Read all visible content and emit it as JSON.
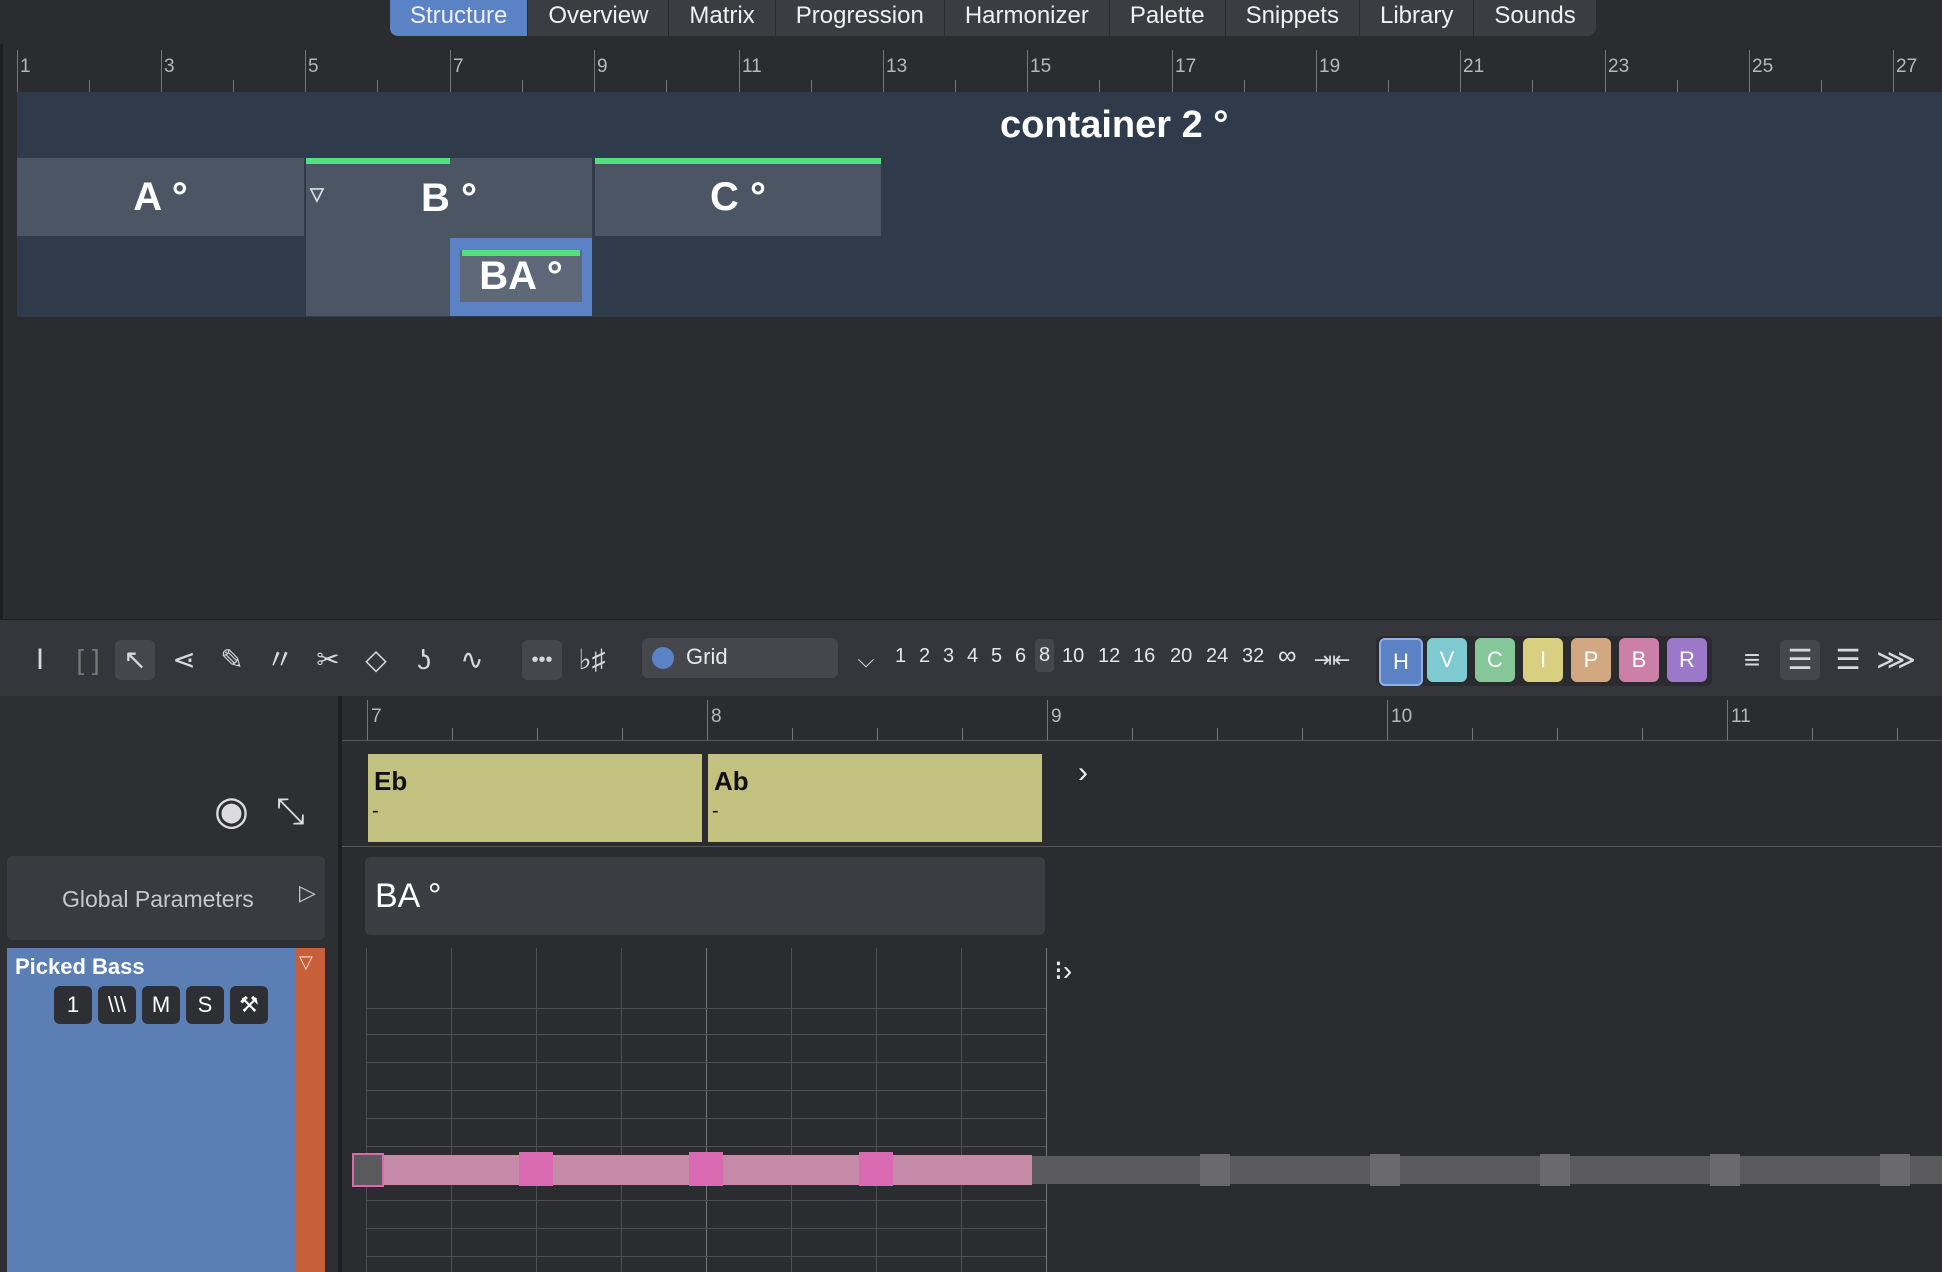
{
  "tabs": [
    {
      "label": "Structure",
      "active": true
    },
    {
      "label": "Overview"
    },
    {
      "label": "Matrix"
    },
    {
      "label": "Progression"
    },
    {
      "label": "Harmonizer"
    },
    {
      "label": "Palette"
    },
    {
      "label": "Snippets"
    },
    {
      "label": "Library"
    },
    {
      "label": "Sounds"
    }
  ],
  "structure": {
    "ruler_labels": [
      "1",
      "3",
      "5",
      "7",
      "9",
      "11",
      "13",
      "15",
      "17",
      "19",
      "21",
      "23",
      "25",
      "27"
    ],
    "container_label": "container 2 °",
    "parts": {
      "a": "A °",
      "b": "B °",
      "c": "C °",
      "ba": "BA °"
    }
  },
  "toolbar": {
    "grid_label": "Grid",
    "grid_values": [
      "1",
      "2",
      "3",
      "4",
      "5",
      "6",
      "8",
      "10",
      "12",
      "16",
      "20",
      "24",
      "32",
      "∞"
    ],
    "grid_selected": "8",
    "track_toggles": [
      "H",
      "V",
      "C",
      "I",
      "P",
      "B",
      "R"
    ],
    "track_toggle_colors": [
      "#5a82c4",
      "#7fc9d0",
      "#86c79a",
      "#d9cf80",
      "#d2a882",
      "#cc7fa8",
      "#9b78c8"
    ]
  },
  "editor": {
    "ruler_labels": [
      "7",
      "8",
      "9",
      "10",
      "11"
    ],
    "chords": [
      {
        "name": "Eb",
        "detail": "-"
      },
      {
        "name": "Ab",
        "detail": "-"
      }
    ],
    "part_label": "BA °",
    "global_parameters": "Global Parameters",
    "track": {
      "name": "Picked Bass",
      "channel": "1",
      "buttons": [
        "\\\\\\",
        "M",
        "S"
      ]
    }
  }
}
